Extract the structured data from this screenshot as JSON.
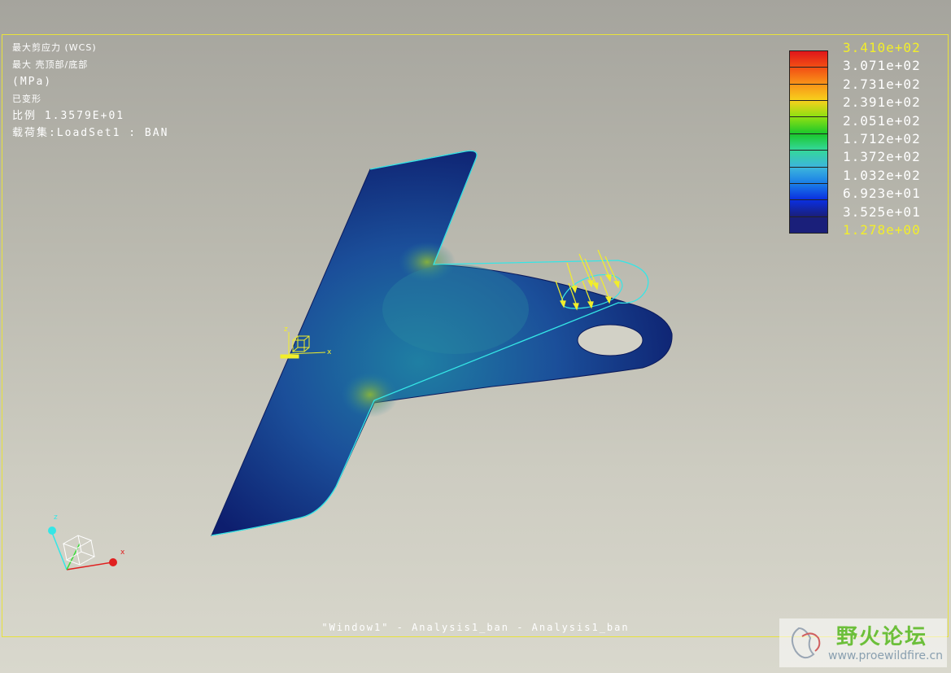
{
  "info": {
    "line1": "最大剪应力 (WCS)",
    "line2": "最大 壳顶部/底部",
    "line3": "(MPa)",
    "line4": "已变形",
    "line5": "比例  1.3579E+01",
    "line6": "载荷集:LoadSet1 :  BAN"
  },
  "legend": {
    "labels": [
      "3.410e+02",
      "3.071e+02",
      "2.731e+02",
      "2.391e+02",
      "2.051e+02",
      "1.712e+02",
      "1.372e+02",
      "1.032e+02",
      "6.923e+01",
      "3.525e+01",
      "1.278e+00"
    ],
    "colors": [
      "#e0161b",
      "#f24e14",
      "#f99418",
      "#f7d01c",
      "#8fe012",
      "#1bc82c",
      "#34d79a",
      "#3cb5dc",
      "#1a7ee8",
      "#0a2fe0",
      "#1a1f7a"
    ],
    "highlight_color": "#f2ee2a"
  },
  "triad": {
    "z": "z",
    "x": "x"
  },
  "csys_marker": {
    "z": "z",
    "x": "x"
  },
  "window_caption": "\"Window1\" - Analysis1_ban - Analysis1_ban",
  "watermark": {
    "title": "野火论坛",
    "url": "www.proewildfire.cn"
  }
}
